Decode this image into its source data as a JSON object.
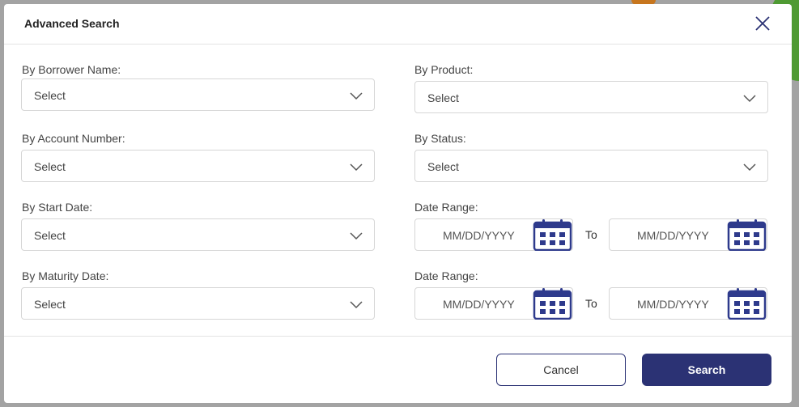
{
  "dialog": {
    "title": "Advanced Search"
  },
  "fields": {
    "borrower_name": {
      "label": "By Borrower Name:",
      "value": "Select"
    },
    "product": {
      "label": "By Product:",
      "value": "Select"
    },
    "account_number": {
      "label": "By Account Number:",
      "value": "Select"
    },
    "status": {
      "label": "By Status:",
      "value": "Select"
    },
    "start_date": {
      "label": "By Start Date:",
      "value": "Select"
    },
    "maturity_date": {
      "label": "By Maturity Date:",
      "value": "Select"
    },
    "date_range_1": {
      "label": "Date Range:",
      "from_placeholder": "MM/DD/YYYY",
      "to_label": "To",
      "to_placeholder": "MM/DD/YYYY"
    },
    "date_range_2": {
      "label": "Date Range:",
      "from_placeholder": "MM/DD/YYYY",
      "to_label": "To",
      "to_placeholder": "MM/DD/YYYY"
    }
  },
  "footer": {
    "cancel_label": "Cancel",
    "search_label": "Search"
  },
  "icons": {
    "close": "close-icon",
    "chevron": "chevron-down-icon",
    "calendar": "calendar-icon"
  },
  "colors": {
    "primary": "#2b3274",
    "calendar": "#2e3a8c"
  }
}
